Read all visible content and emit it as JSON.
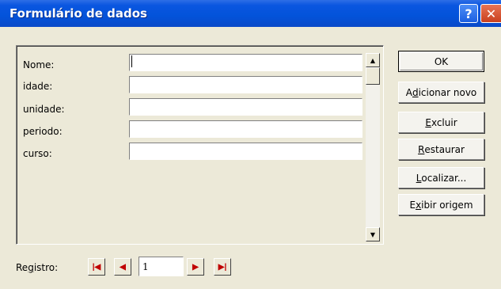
{
  "window": {
    "title": "Formulário de dados",
    "help_glyph": "?",
    "close_glyph": "✕"
  },
  "fields": [
    {
      "label": "Nome:",
      "value": ""
    },
    {
      "label": "idade:",
      "value": ""
    },
    {
      "label": "unidade:",
      "value": ""
    },
    {
      "label": "periodo:",
      "value": ""
    },
    {
      "label": "curso:",
      "value": ""
    }
  ],
  "buttons": {
    "ok": {
      "pre": "OK",
      "mn": "",
      "post": ""
    },
    "add_new": {
      "pre": "A",
      "mn": "d",
      "post": "icionar novo"
    },
    "delete": {
      "pre": "",
      "mn": "E",
      "post": "xcluir"
    },
    "restore": {
      "pre": "",
      "mn": "R",
      "post": "estaurar"
    },
    "find": {
      "pre": "",
      "mn": "L",
      "post": "ocalizar..."
    },
    "show_source": {
      "pre": "E",
      "mn": "x",
      "post": "ibir origem"
    }
  },
  "navigation": {
    "label_pre": "Re",
    "label_mn": "g",
    "label_post": "istro:",
    "record_number": "1"
  }
}
